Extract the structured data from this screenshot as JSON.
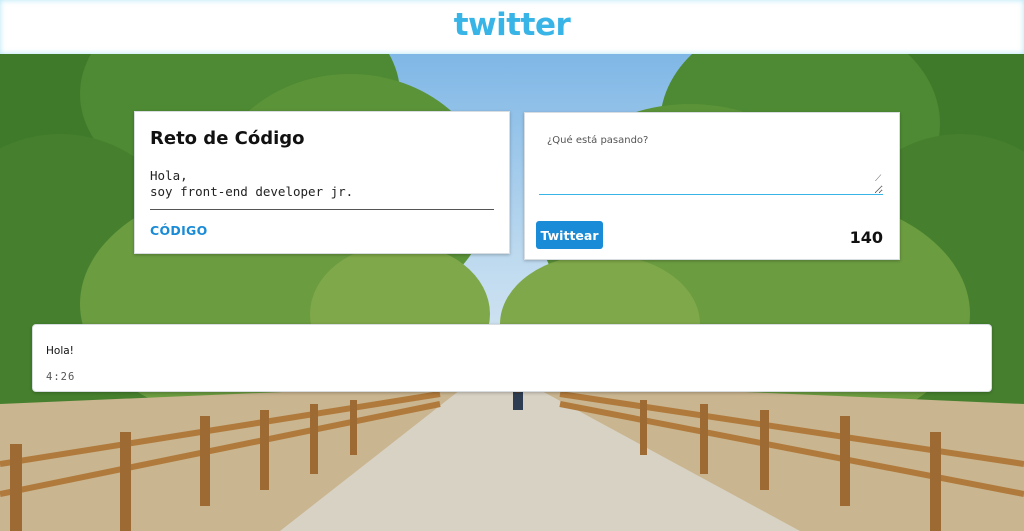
{
  "header": {
    "logo_text": "twitter"
  },
  "profile": {
    "title": "Reto de Código",
    "bio": "Hola,\nsoy front-end developer jr.",
    "link_label": "CÓDIGO"
  },
  "compose": {
    "placeholder": "¿Qué está pasando?",
    "value": "",
    "button_label": "Twittear",
    "char_count": "140"
  },
  "tweets": [
    {
      "text": "Hola!",
      "time": "4:26"
    }
  ],
  "colors": {
    "brand": "#38b4e6",
    "button": "#1a8bd6",
    "link": "#1a8bd6"
  },
  "icons": {
    "logo": "twitter-wordmark",
    "resize": "resize-grip-icon"
  }
}
